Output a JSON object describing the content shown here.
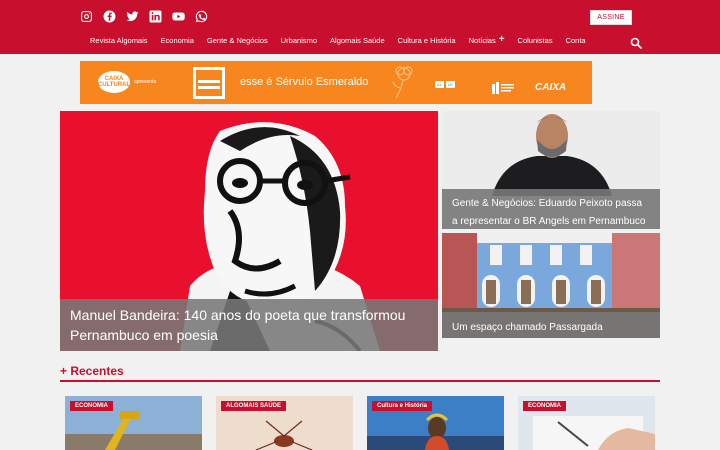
{
  "social_icons": [
    "instagram-icon",
    "facebook-icon",
    "twitter-icon",
    "linkedin-icon",
    "youtube-icon",
    "whatsapp-icon"
  ],
  "header": {
    "subscribe_label": "ASSINE"
  },
  "nav": {
    "items": [
      "Revista Algomais",
      "Economia",
      "Gente & Negócios",
      "Urbanismo",
      "Algomais Saúde",
      "Cultura e História",
      "Notícias",
      "Colunistas",
      "Conta"
    ],
    "expand_glyph": "+"
  },
  "banner": {
    "caixa_cultural": "CAIXA CULTURAL",
    "apresenta": "apresenta",
    "title": "esse é Sérvulo Esmeraldo",
    "badges": [
      "AL",
      "LE"
    ],
    "caixa": "CAIXA"
  },
  "hero": {
    "headline": "Manuel Bandeira: 140 anos do poeta que transformou Pernambuco em poesia"
  },
  "side_stories": [
    {
      "headline": "Gente & Negócios: Eduardo Peixoto passa a representar o BR Angels em Pernambuco"
    },
    {
      "headline": "Um espaço chamado Passargada"
    }
  ],
  "recentes": {
    "title": "+ Recentes"
  },
  "cards": [
    {
      "tag": "ECONOMIA"
    },
    {
      "tag": "ALGOMAIS SAÚDE"
    },
    {
      "tag": "Cultura e História"
    },
    {
      "tag": "ECONOMIA"
    }
  ],
  "colors": {
    "brand": "#c8102e",
    "banner": "#f7861e"
  }
}
